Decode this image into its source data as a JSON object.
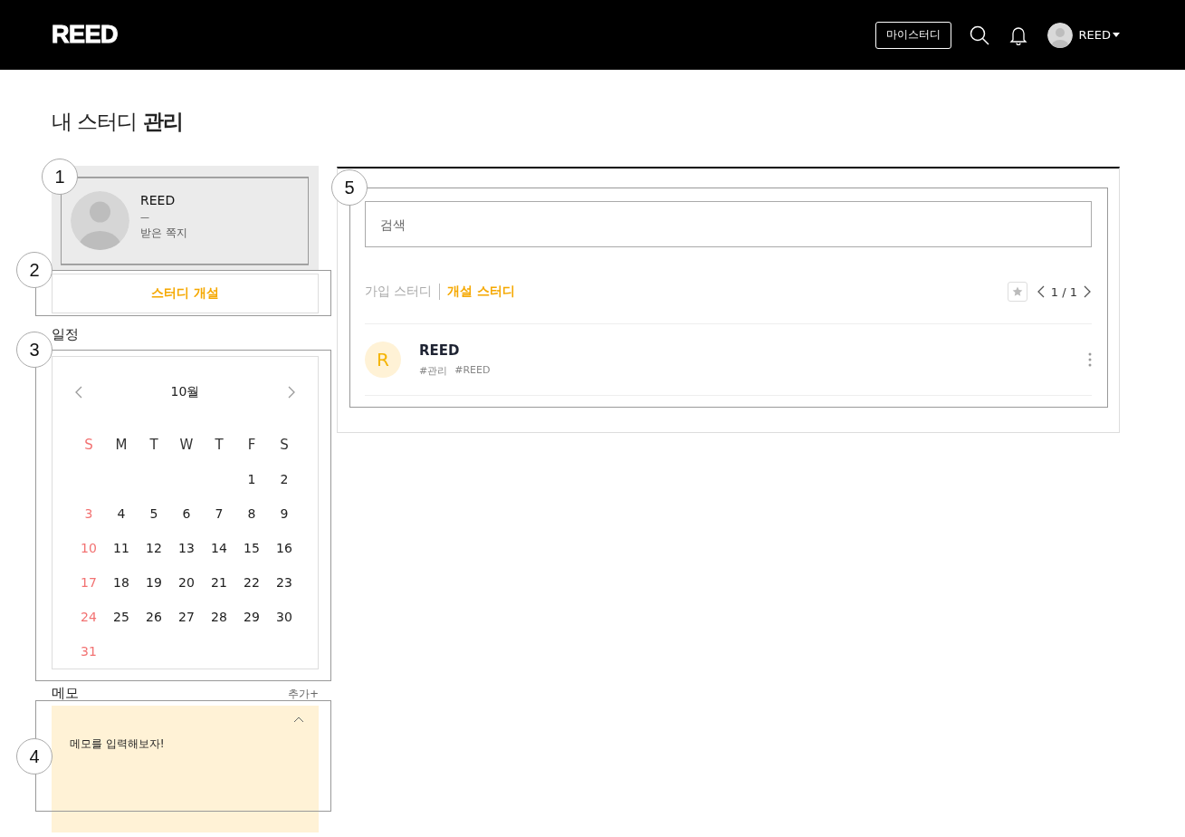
{
  "header": {
    "logo": "REED",
    "my_study_button": "마이스터디",
    "user_name": "REED"
  },
  "page_title": {
    "prefix": "내 스터디",
    "emphasis": "관리"
  },
  "profile": {
    "name": "REED",
    "divider": "—",
    "messages_link": "받은 쪽지"
  },
  "create_study_button": "스터디 개설",
  "schedule": {
    "title": "일정",
    "month": "10월",
    "weekdays": [
      "S",
      "M",
      "T",
      "W",
      "T",
      "F",
      "S"
    ],
    "weeks": [
      [
        "1",
        "2"
      ],
      [
        "3",
        "4",
        "5",
        "6",
        "7",
        "8",
        "9"
      ],
      [
        "10",
        "11",
        "12",
        "13",
        "14",
        "15",
        "16"
      ],
      [
        "17",
        "18",
        "19",
        "20",
        "21",
        "22",
        "23"
      ],
      [
        "24",
        "25",
        "26",
        "27",
        "28",
        "29",
        "30"
      ],
      [
        "31"
      ]
    ]
  },
  "memo": {
    "title": "메모",
    "add_button": "추가+",
    "text": "메모를 입력해보자!",
    "expanded": true
  },
  "study_panel": {
    "search": {
      "placeholder": "검색"
    },
    "tabs": [
      {
        "label": "가입 스터디",
        "selected": false
      },
      {
        "label": "개설 스터디",
        "selected": true
      }
    ],
    "pager": "1 / 1",
    "studies": [
      {
        "initial": "R",
        "name": "REED",
        "tags": [
          "#관리",
          "#REED"
        ]
      }
    ]
  },
  "annotations": [
    "1",
    "2",
    "3",
    "4",
    "5"
  ]
}
